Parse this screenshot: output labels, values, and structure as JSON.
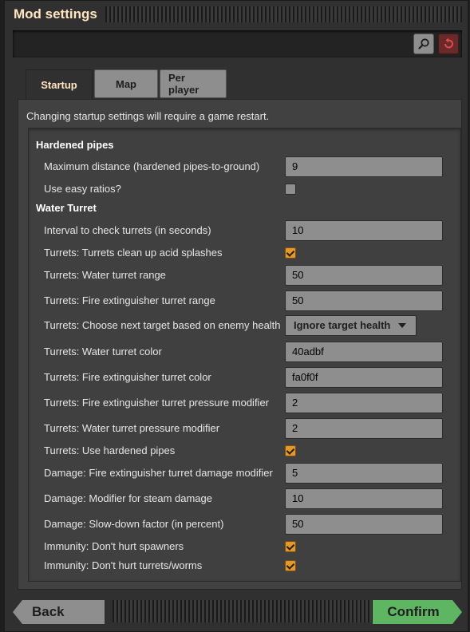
{
  "window": {
    "title": "Mod settings"
  },
  "tabs": [
    {
      "label": "Startup",
      "active": true
    },
    {
      "label": "Map",
      "active": false
    },
    {
      "label": "Per player",
      "active": false
    }
  ],
  "notice": "Changing startup settings will require a game restart.",
  "sections": {
    "hardened_pipes": "Hardened pipes",
    "water_turret": "Water Turret"
  },
  "settings": {
    "max_distance": {
      "label": "Maximum distance (hardened pipes-to-ground)",
      "value": "9"
    },
    "easy_ratios": {
      "label": "Use easy ratios?",
      "checked": false
    },
    "interval": {
      "label": "Interval to check turrets (in seconds)",
      "value": "10"
    },
    "clean_acid": {
      "label": "Turrets: Turrets clean up acid splashes",
      "checked": true
    },
    "water_range": {
      "label": "Turrets: Water turret range",
      "value": "50"
    },
    "fire_range": {
      "label": "Turrets: Fire extinguisher turret range",
      "value": "50"
    },
    "target": {
      "label": "Turrets: Choose next target based on enemy health",
      "value": "Ignore target health"
    },
    "water_color": {
      "label": "Turrets: Water turret color",
      "value": "40adbf"
    },
    "fire_color": {
      "label": "Turrets: Fire extinguisher turret color",
      "value": "fa0f0f"
    },
    "fire_pressure": {
      "label": "Turrets: Fire extinguisher turret pressure modifier",
      "value": "2"
    },
    "water_pressure": {
      "label": "Turrets: Water turret pressure modifier",
      "value": "2"
    },
    "hardened_pipes": {
      "label": "Turrets: Use hardened pipes",
      "checked": true
    },
    "fire_damage": {
      "label": "Damage: Fire extinguisher turret damage modifier",
      "value": "5"
    },
    "steam_damage": {
      "label": "Damage: Modifier for steam damage",
      "value": "10"
    },
    "slowdown": {
      "label": "Damage: Slow-down factor (in percent)",
      "value": "50"
    },
    "spawners": {
      "label": "Immunity: Don't hurt spawners",
      "checked": true
    },
    "turrets_worms": {
      "label": "Immunity: Don't hurt turrets/worms",
      "checked": true
    }
  },
  "footer": {
    "back_label": "Back",
    "confirm_label": "Confirm"
  },
  "colors": {
    "accent": "#e39827",
    "confirm": "#5eb663",
    "title": "#ffe6c0"
  },
  "icons": {
    "search": "search-icon",
    "reset": "reset-icon"
  }
}
